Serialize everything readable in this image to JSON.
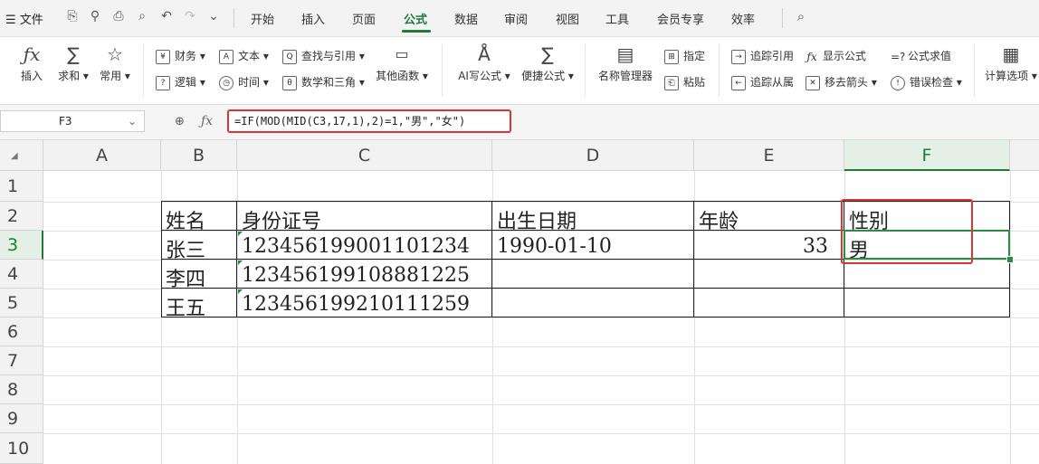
{
  "menu": {
    "file_label": "文件",
    "tabs": [
      "开始",
      "插入",
      "页面",
      "公式",
      "数据",
      "审阅",
      "视图",
      "工具",
      "会员专享",
      "效率"
    ],
    "active_tab": "公式"
  },
  "ribbon": {
    "insert": "插入",
    "sum": "求和",
    "common": "常用",
    "finance": "财务",
    "text": "文本",
    "lookup": "查找与引用",
    "logic": "逻辑",
    "time": "时间",
    "math": "数学和三角",
    "other_funcs": "其他函数",
    "ai_formula": "AI写公式",
    "quick_formula": "便捷公式",
    "name_manager": "名称管理器",
    "specify": "指定",
    "paste": "粘贴",
    "trace_precedents": "追踪引用",
    "trace_dependents": "追踪从属",
    "show_formula": "显示公式",
    "remove_arrows": "移去箭头",
    "formula_eval": "公式求值",
    "error_check": "错误检查",
    "calc_options": "计算选项"
  },
  "formula_bar": {
    "name_box": "F3",
    "formula": "=IF(MOD(MID(C3,17,1),2)=1,\"男\",\"女\")"
  },
  "sheet": {
    "columns": [
      "A",
      "B",
      "C",
      "D",
      "E",
      "F"
    ],
    "rows": [
      "1",
      "2",
      "3",
      "4",
      "5",
      "6",
      "7",
      "8",
      "9",
      "10"
    ],
    "selected_cell": "F3",
    "header": {
      "name": "姓名",
      "id": "身份证号",
      "birth": "出生日期",
      "age": "年龄",
      "gender": "性别"
    },
    "data": [
      {
        "name": "张三",
        "id": "123456199001101234",
        "birth": "1990-01-10",
        "age": "33",
        "gender": "男"
      },
      {
        "name": "李四",
        "id": "123456199108881225",
        "birth": "",
        "age": "",
        "gender": ""
      },
      {
        "name": "王五",
        "id": "123456199210111259",
        "birth": "",
        "age": "",
        "gender": ""
      }
    ]
  },
  "colors": {
    "accent": "#1f7a3a",
    "highlight": "#d9362f"
  }
}
